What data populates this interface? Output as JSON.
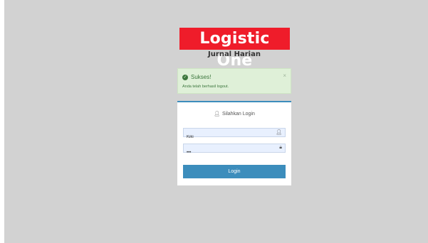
{
  "brand": {
    "logo_text": "Logistic One",
    "subtitle": "Jurnal Harian",
    "logo_color": "#ef1c2a"
  },
  "alert": {
    "title": "Sukses!",
    "message": "Anda telah berhasil logout.",
    "close_glyph": "×",
    "background": "#dff0d8",
    "icon": "check-circle-icon"
  },
  "login": {
    "heading": "Silahkan Login",
    "heading_icon": "user-icon",
    "username_value": "Kiki",
    "username_icon": "user-icon",
    "password_value": "•••",
    "password_icon": "lock-icon",
    "button_label": "Login",
    "accent": "#3c8dbc"
  }
}
